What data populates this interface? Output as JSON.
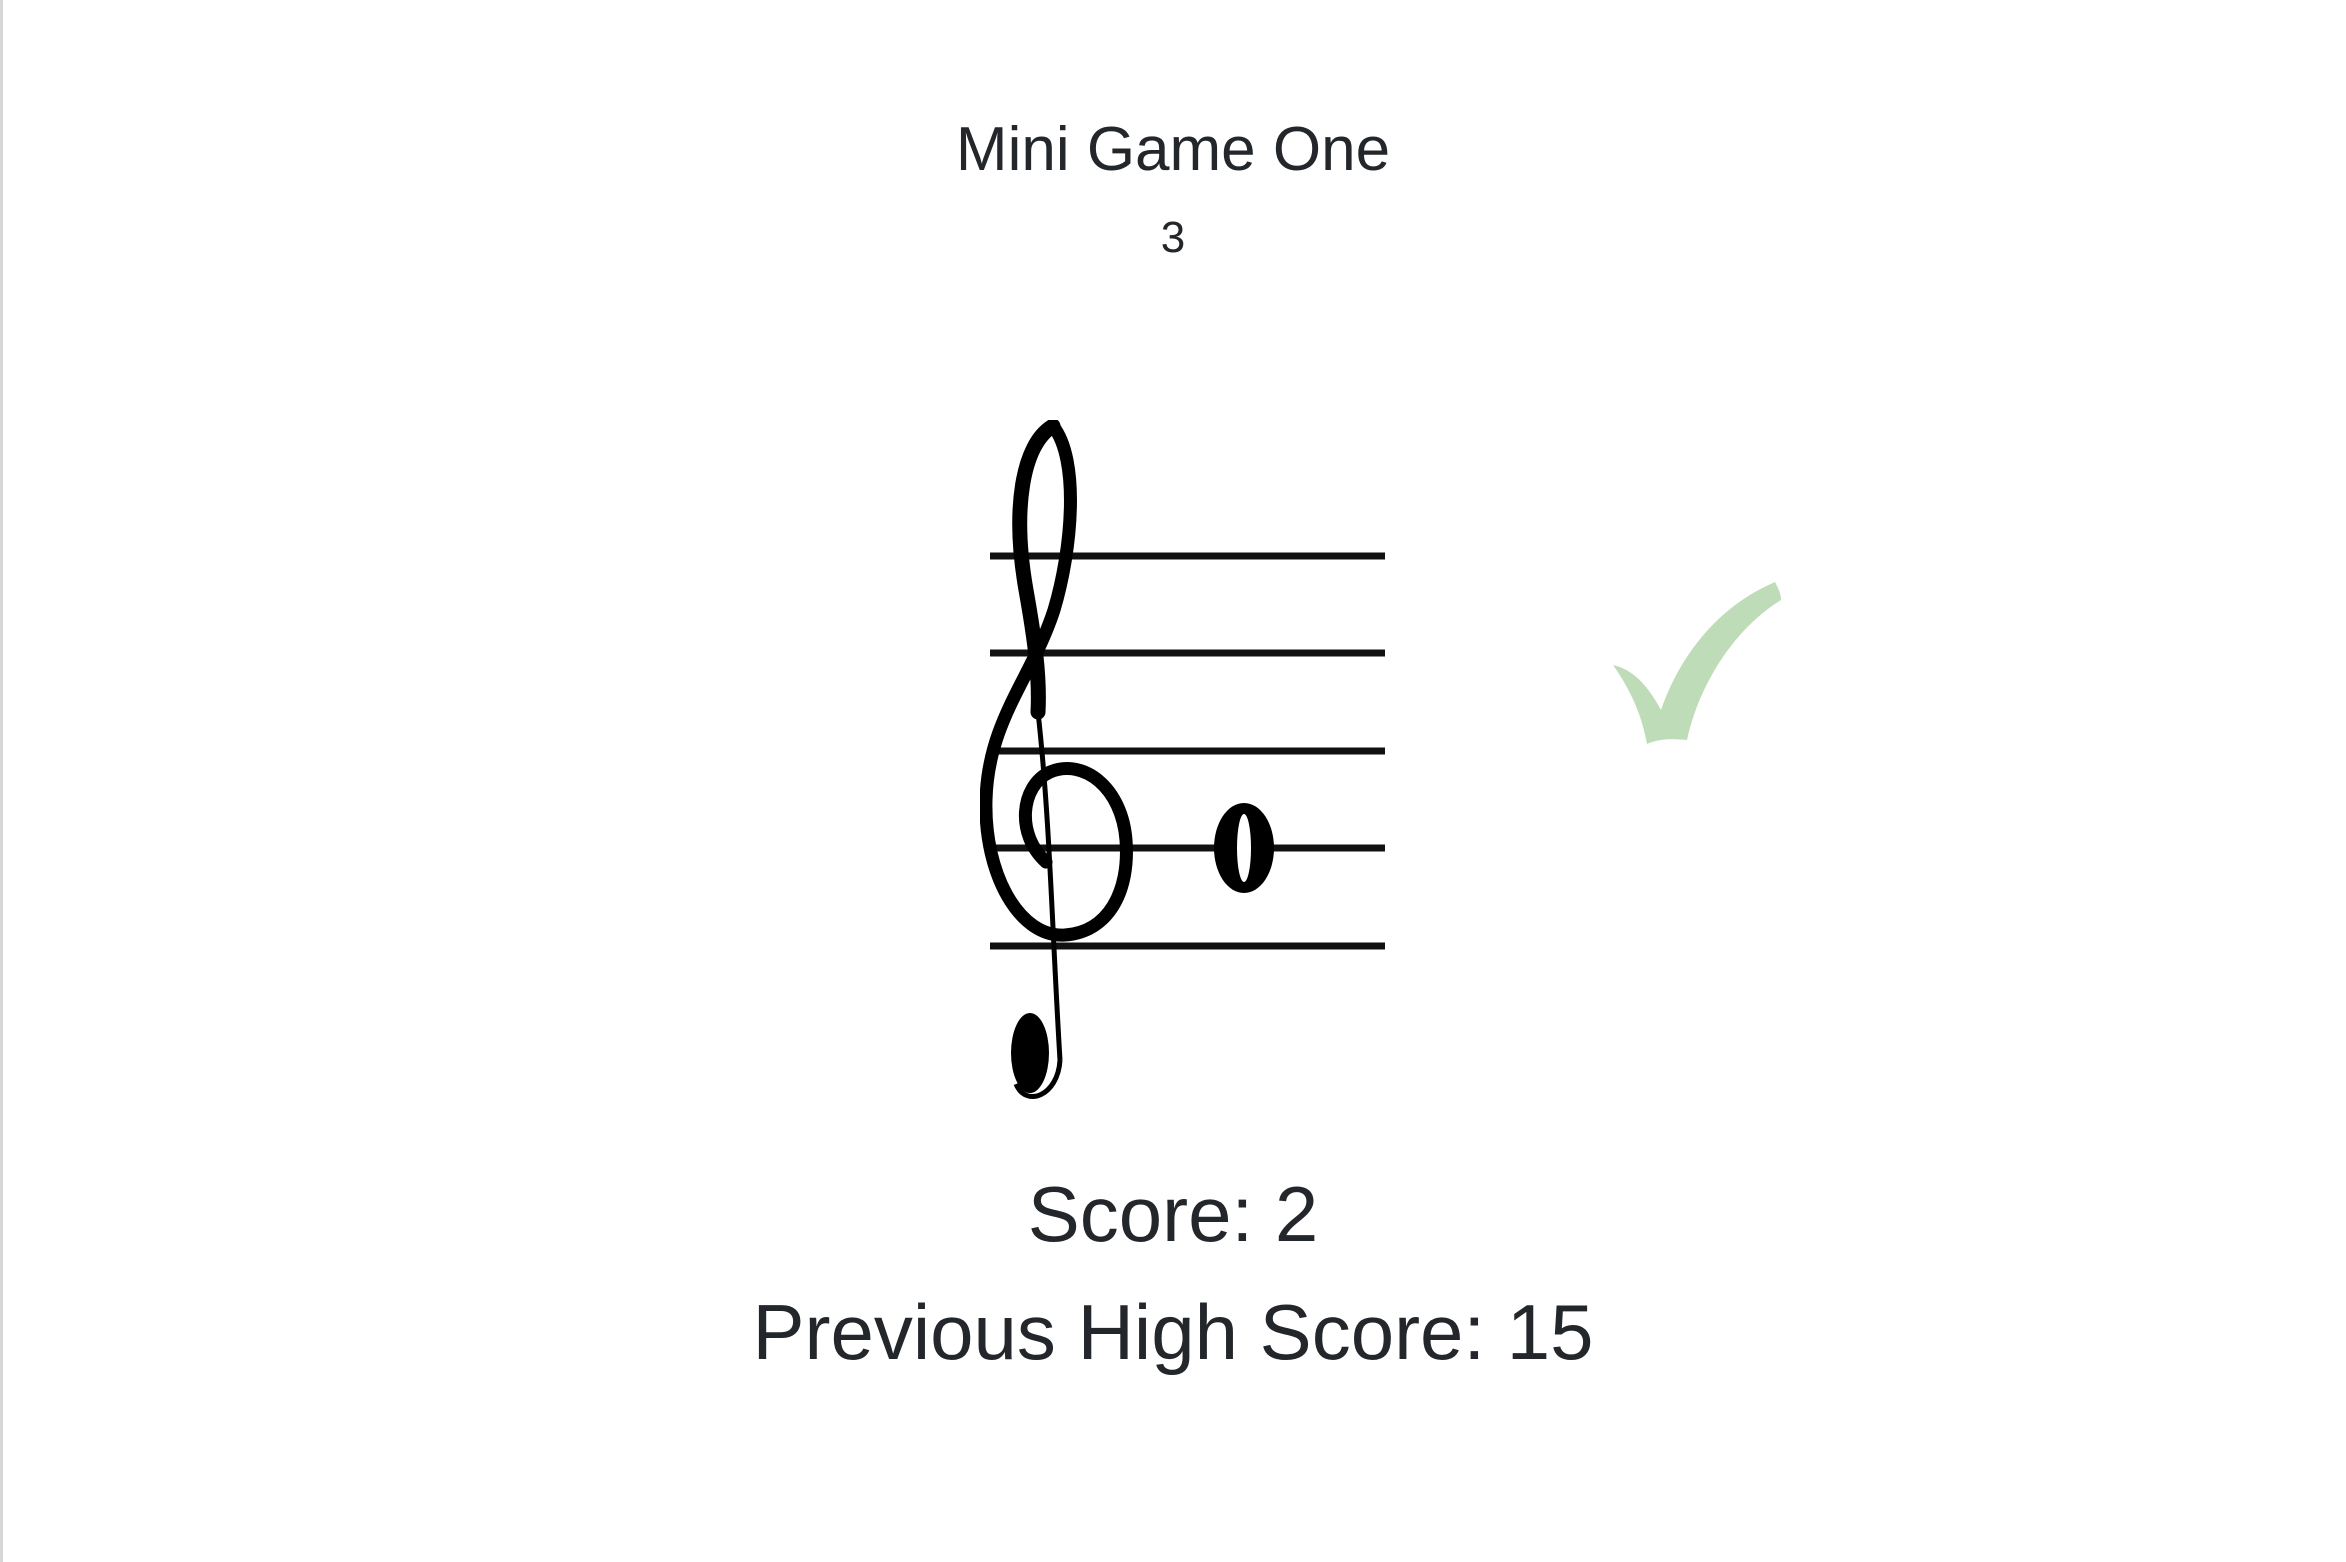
{
  "game": {
    "title": "Mini Game One",
    "timer": "3"
  },
  "staff": {
    "clef": "treble-clef",
    "note": "whole-note",
    "note_position": "fourth line"
  },
  "feedback": {
    "icon": "checkmark-icon",
    "color": "#bfdcb8"
  },
  "score": {
    "current_label": "Score: 2",
    "high_label": "Previous High Score: 15"
  }
}
